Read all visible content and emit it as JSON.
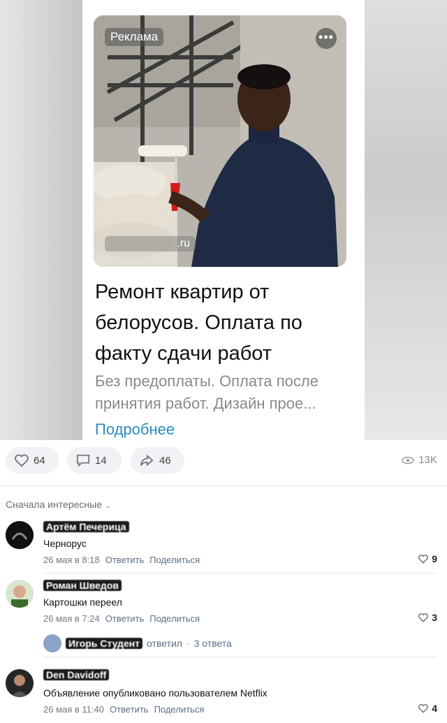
{
  "ad": {
    "badge": "Реклама",
    "more": "•••",
    "domain": ".ru",
    "title": "Ремонт квартир от белорусов. Оплата по факту сдачи работ",
    "description": "Без предоплаты. Оплата после принятия работ. Дизайн прое...",
    "link": "Подробнее"
  },
  "actions": {
    "likes": "64",
    "comments": "14",
    "shares": "46",
    "views": "13K"
  },
  "sort_label": "Сначала интересные",
  "comments": [
    {
      "author": "Артём Печерица",
      "text": "Чернорус",
      "date": "26 мая в 8:18",
      "reply": "Ответить",
      "share": "Поделиться",
      "likes": "9"
    },
    {
      "author": "Роман Шведов",
      "text": "Картошки переел",
      "date": "26 мая в 7:24",
      "reply": "Ответить",
      "share": "Поделиться",
      "likes": "3",
      "thread": {
        "author": "Игорь Студент",
        "replied": "ответил",
        "count": "3 ответа"
      }
    },
    {
      "author": "Den Davidoff",
      "text": "Объявление опубликовано пользователем Netflix",
      "date": "26 мая в 11:40",
      "reply": "Ответить",
      "share": "Поделиться",
      "likes": "4"
    }
  ],
  "colors": {
    "link": "#2a8cbf",
    "action_link": "#5a6e85",
    "pill_bg": "#f0f2f5"
  }
}
